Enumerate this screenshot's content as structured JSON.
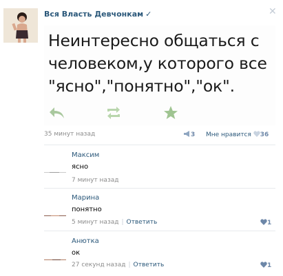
{
  "post": {
    "group_name": "Вся Власть Девчонкам",
    "verified_icon": "check-icon",
    "quote_lines": [
      "Неинтересно общаться с",
      "человеком,у которого все",
      "\"ясно\",\"понятно\",\"ок\"."
    ],
    "time": "35 минут назад",
    "reposts": "3",
    "like_label": "Мне нравится",
    "likes": "36"
  },
  "comments": [
    {
      "author": "Максим",
      "text": "ясно",
      "time": "7 минут назад",
      "reply": "",
      "likes": ""
    },
    {
      "author": "Марина",
      "text": "понятно",
      "time": "5 минут назад",
      "reply": "Ответить",
      "likes": "1"
    },
    {
      "author": "Анютка",
      "text": "ок",
      "time": "27 секунд назад",
      "reply": "Ответить",
      "likes": "1"
    }
  ],
  "colors": {
    "link": "#2b587a",
    "muted": "#8c8c8c",
    "icon_green": "#7aa86a",
    "heart": "#6d87a8"
  }
}
